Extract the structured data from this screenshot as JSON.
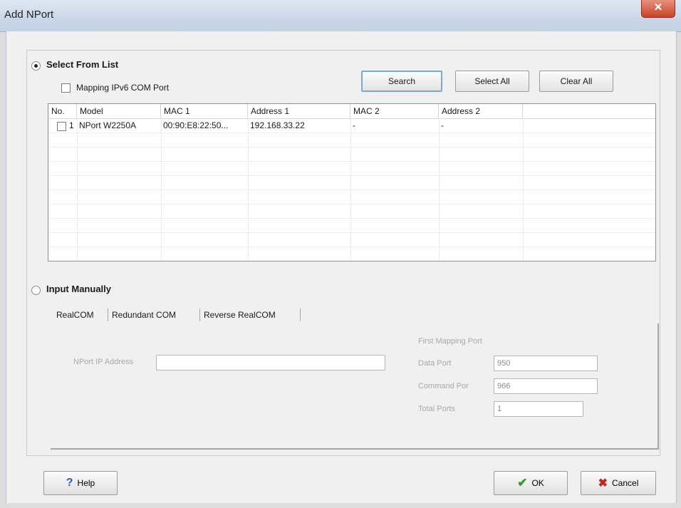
{
  "window": {
    "title": "Add NPort",
    "close_glyph": "✕"
  },
  "select_from_list": {
    "label": "Select From List",
    "mapping_ipv6_label": "Mapping IPv6 COM Port",
    "buttons": {
      "search": "Search",
      "select_all": "Select All",
      "clear_all": "Clear All"
    },
    "columns": [
      "No.",
      "Model",
      "MAC 1",
      "Address 1",
      "MAC 2",
      "Address 2"
    ],
    "rows": [
      {
        "no": "1",
        "model": "NPort W2250A",
        "mac1": "00:90:E8:22:50...",
        "address1": "192.168.33.22",
        "mac2": "-",
        "address2": "-"
      }
    ]
  },
  "input_manually": {
    "label": "Input Manually",
    "tabs": [
      "RealCOM",
      "Redundant COM",
      "Reverse RealCOM"
    ],
    "nport_ip_label": "NPort IP Address",
    "nport_ip_value": "",
    "first_mapping_port_label": "First Mapping Port",
    "data_port_label": "Data Port",
    "data_port_value": "950",
    "command_port_label": "Command Por",
    "command_port_value": "966",
    "total_ports_label": "Total Ports",
    "total_ports_value": "1"
  },
  "footer": {
    "help": "Help",
    "ok": "OK",
    "cancel": "Cancel"
  },
  "icons": {
    "help": "help-icon",
    "ok": "checkmark-icon",
    "cancel": "x-icon"
  }
}
